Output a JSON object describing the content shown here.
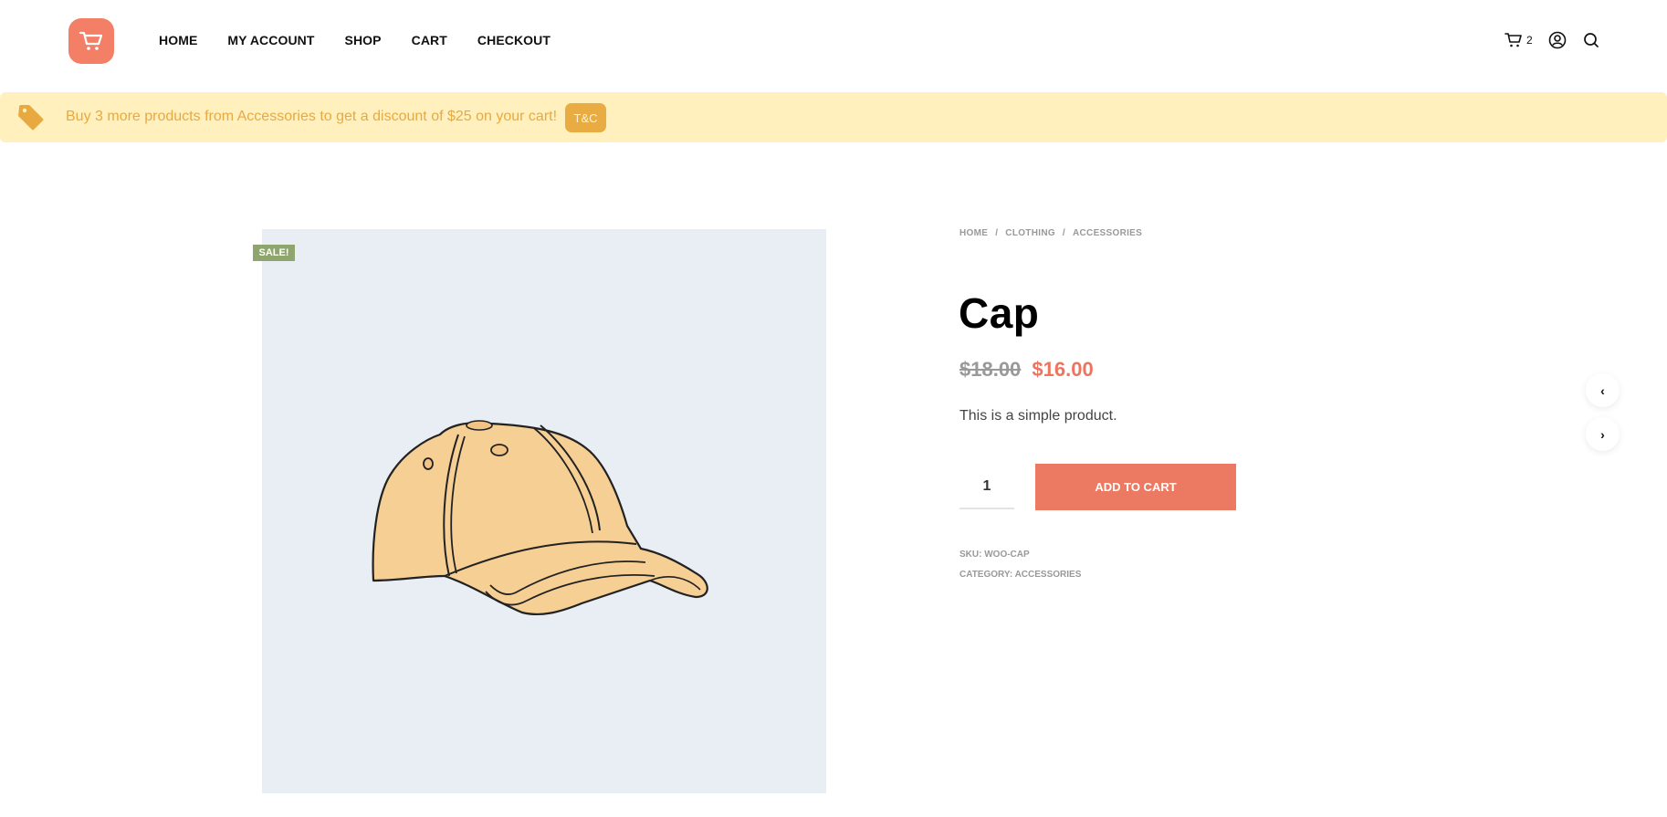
{
  "header": {
    "logo_icon": "shopping-cart-icon",
    "nav": [
      {
        "label": "HOME"
      },
      {
        "label": "MY ACCOUNT"
      },
      {
        "label": "SHOP"
      },
      {
        "label": "CART"
      },
      {
        "label": "CHECKOUT"
      }
    ],
    "cart_count": "2",
    "icons": [
      "cart-icon",
      "account-icon",
      "search-icon"
    ]
  },
  "notice": {
    "icon": "price-tag-icon",
    "text": "Buy 3 more products from Accessories to get a discount of $25 on your cart!",
    "button_label": "T&C"
  },
  "product": {
    "sale_badge": "SALE!",
    "breadcrumb": [
      {
        "label": "HOME"
      },
      {
        "label": "CLOTHING"
      },
      {
        "label": "ACCESSORIES"
      }
    ],
    "title": "Cap",
    "regular_price": "$18.00",
    "sale_price": "$16.00",
    "description": "This is a simple product.",
    "quantity": "1",
    "add_to_cart_label": "ADD TO CART",
    "sku_label": "SKU:",
    "sku": "WOO-CAP",
    "category_label": "CATEGORY:",
    "category": "ACCESSORIES"
  },
  "navigation": {
    "prev_label": "‹",
    "next_label": "›"
  },
  "colors": {
    "accent": "#ec7a62",
    "notice_bg": "#fff0bd",
    "notice_text": "#e8a940",
    "sale_badge": "#8ea56d",
    "gallery_bg": "#e8eef3"
  }
}
